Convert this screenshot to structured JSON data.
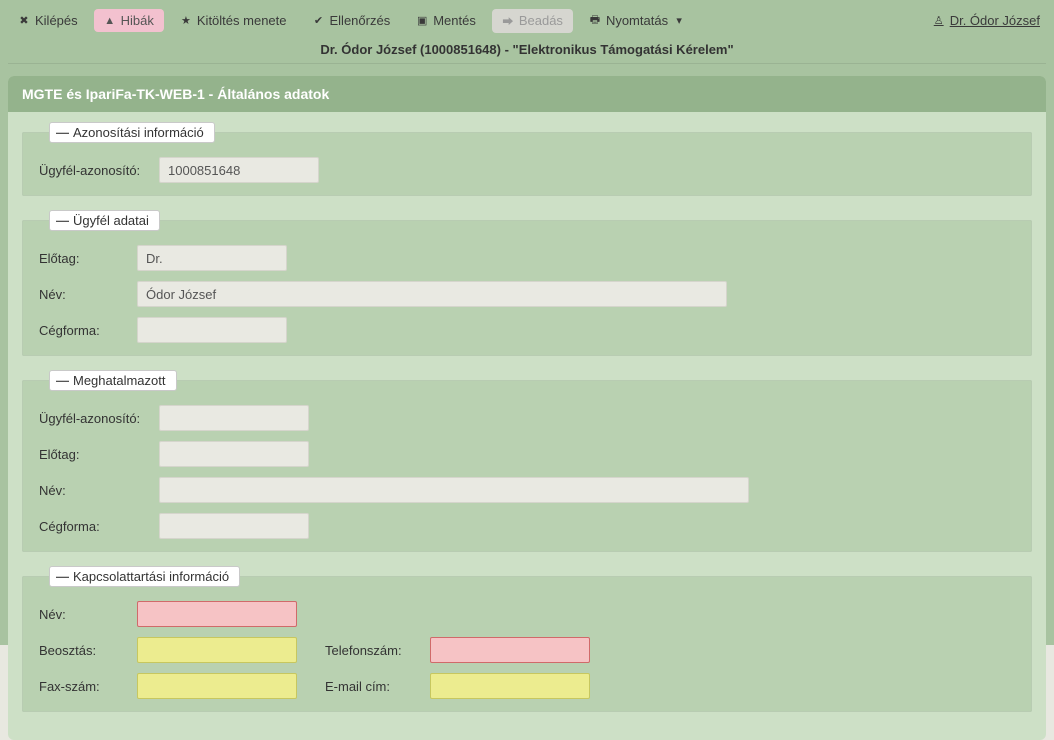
{
  "toolbar": {
    "exit": "Kilépés",
    "errors": "Hibák",
    "fill_steps": "Kitöltés menete",
    "check": "Ellenőrzés",
    "save": "Mentés",
    "submit": "Beadás",
    "print": "Nyomtatás"
  },
  "user_name": "Dr. Ódor József",
  "breadcrumb": "Dr. Ódor József (1000851648) - \"Elektronikus Támogatási Kérelem\"",
  "page_title": "MGTE és IpariFa-TK-WEB-1 - Általános adatok",
  "sections": {
    "ident": {
      "legend": "Azonosítási információ",
      "client_id_label": "Ügyfél-azonosító:",
      "client_id_value": "1000851648"
    },
    "client": {
      "legend": "Ügyfél adatai",
      "prefix_label": "Előtag:",
      "prefix_value": "Dr.",
      "name_label": "Név:",
      "name_value": "Ódor József",
      "company_form_label": "Cégforma:",
      "company_form_value": ""
    },
    "proxy": {
      "legend": "Meghatalmazott",
      "client_id_label": "Ügyfél-azonosító:",
      "client_id_value": "",
      "prefix_label": "Előtag:",
      "prefix_value": "",
      "name_label": "Név:",
      "name_value": "",
      "company_form_label": "Cégforma:",
      "company_form_value": ""
    },
    "contact": {
      "legend": "Kapcsolattartási információ",
      "name_label": "Név:",
      "name_value": "",
      "position_label": "Beosztás:",
      "position_value": "",
      "phone_label": "Telefonszám:",
      "phone_value": "",
      "fax_label": "Fax-szám:",
      "fax_value": "",
      "email_label": "E-mail cím:",
      "email_value": ""
    }
  }
}
